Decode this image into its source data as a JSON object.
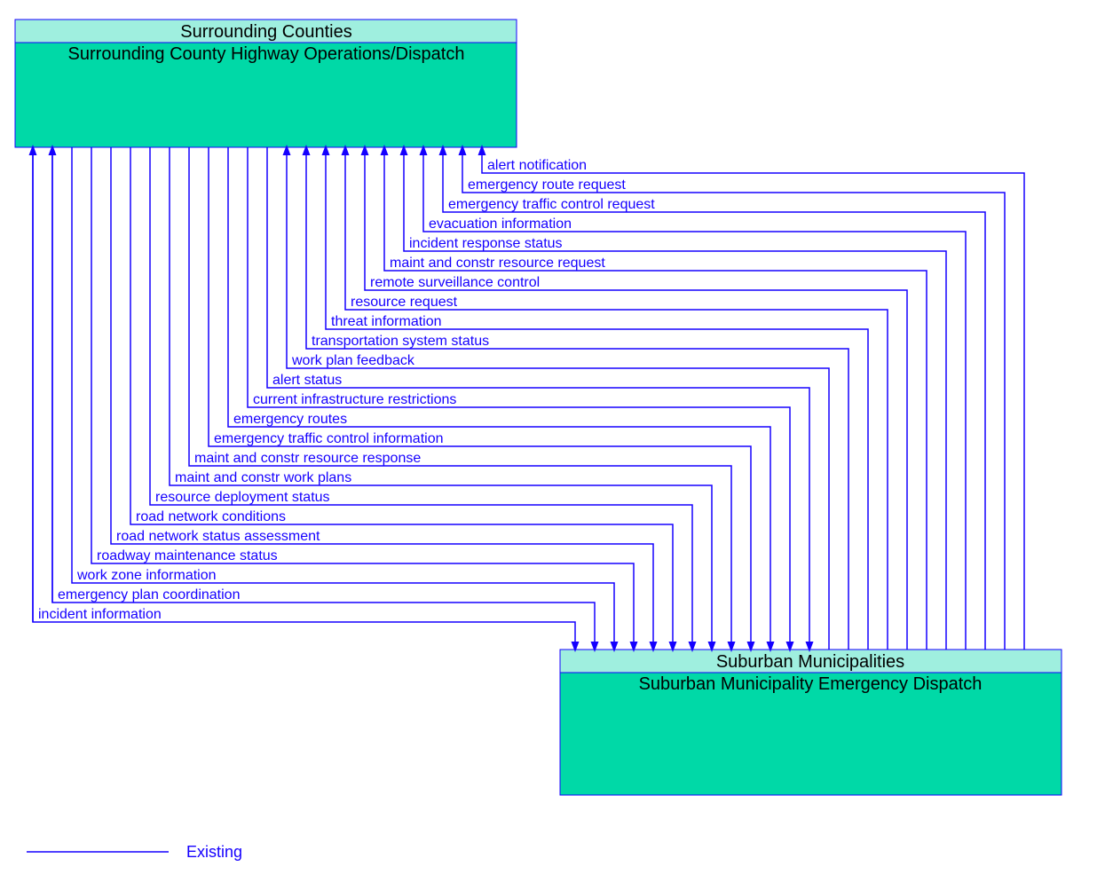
{
  "source": {
    "header": "Surrounding Counties",
    "body": "Surrounding County Highway Operations/Dispatch"
  },
  "destination": {
    "header": "Suburban Municipalities",
    "body": "Suburban Municipality Emergency Dispatch"
  },
  "legend": {
    "existing": "Existing"
  },
  "flows_to_source": [
    "alert notification",
    "emergency route request",
    "emergency traffic control request",
    "evacuation information",
    "incident response status",
    "maint and constr resource request",
    "remote surveillance control",
    "resource request",
    "threat information",
    "transportation system status",
    "work plan feedback"
  ],
  "flows_to_destination": [
    "alert status",
    "current infrastructure restrictions",
    "emergency routes",
    "emergency traffic control information",
    "maint and constr resource response",
    "maint and constr work plans",
    "resource deployment status",
    "road network conditions",
    "road network status assessment",
    "roadway maintenance status",
    "work zone information"
  ],
  "flows_bidirectional": [
    "emergency plan coordination",
    "incident information"
  ]
}
